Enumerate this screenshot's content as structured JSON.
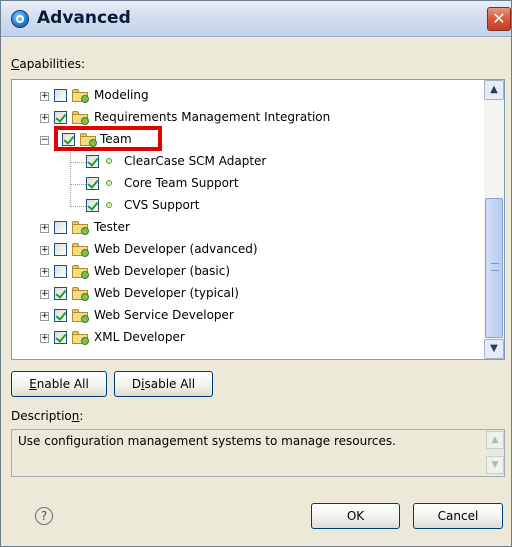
{
  "window": {
    "title": "Advanced",
    "close_glyph": "✕"
  },
  "capabilities": {
    "label_u": "C",
    "label_rest": "apabilities:"
  },
  "tree": {
    "rows": [
      {
        "label": "Modeling",
        "checked": false,
        "icon": "folder-icon"
      },
      {
        "label": "Requirements Management Integration",
        "checked": true,
        "icon": "folder-icon"
      },
      {
        "label": "Team",
        "checked": true,
        "icon": "folder-icon",
        "expanded": true,
        "highlighted": true
      },
      {
        "label": "ClearCase SCM Adapter",
        "checked": true,
        "icon": "capability-dot-icon"
      },
      {
        "label": "Core Team Support",
        "checked": true,
        "icon": "capability-dot-icon"
      },
      {
        "label": "CVS Support",
        "checked": true,
        "icon": "capability-dot-icon"
      },
      {
        "label": "Tester",
        "checked": false,
        "icon": "folder-icon"
      },
      {
        "label": "Web Developer (advanced)",
        "checked": false,
        "icon": "folder-icon"
      },
      {
        "label": "Web Developer (basic)",
        "checked": false,
        "icon": "folder-icon"
      },
      {
        "label": "Web Developer (typical)",
        "checked": true,
        "icon": "folder-icon"
      },
      {
        "label": "Web Service Developer",
        "checked": true,
        "icon": "folder-icon"
      },
      {
        "label": "XML Developer",
        "checked": true,
        "icon": "folder-icon"
      }
    ],
    "expander_plus": "+",
    "expander_minus": "−",
    "scroll_up": "▲",
    "scroll_down": "▼"
  },
  "buttons": {
    "enable_u": "E",
    "enable_rest": "nable All",
    "disable_pre": "D",
    "disable_u": "i",
    "disable_rest": "sable All",
    "ok": "OK",
    "cancel": "Cancel"
  },
  "description": {
    "label_pre": "Descriptio",
    "label_u": "n",
    "label_post": ":",
    "text": "Use configuration management systems to manage resources."
  },
  "help": {
    "glyph": "?"
  }
}
